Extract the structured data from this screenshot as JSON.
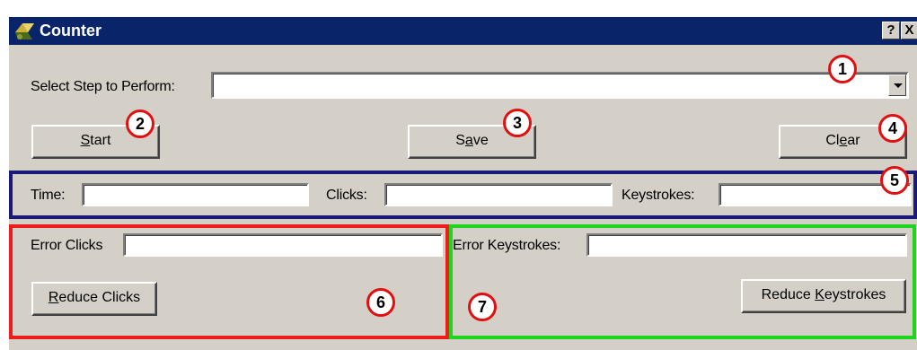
{
  "window": {
    "title": "Counter",
    "help_label": "?",
    "close_label": "X"
  },
  "step": {
    "label": "Select Step to Perform:",
    "value": ""
  },
  "buttons": {
    "start": {
      "pre": "",
      "accel": "S",
      "post": "tart"
    },
    "save": {
      "pre": "S",
      "accel": "a",
      "post": "ve"
    },
    "clear": {
      "pre": "Cl",
      "accel": "e",
      "post": "ar"
    },
    "reduce_clicks": {
      "pre": "",
      "accel": "R",
      "post": "educe Clicks"
    },
    "reduce_keystrokes": {
      "pre": "Reduce ",
      "accel": "K",
      "post": "eystrokes"
    }
  },
  "stats": {
    "time_label": "Time:",
    "time_value": "",
    "clicks_label": "Clicks:",
    "clicks_value": "",
    "keystrokes_label": "Keystrokes:",
    "keystrokes_value": ""
  },
  "errors": {
    "clicks_label": "Error Clicks",
    "clicks_value": "",
    "keystrokes_label": "Error Keystrokes:",
    "keystrokes_value": ""
  },
  "callouts": [
    "1",
    "2",
    "3",
    "4",
    "5",
    "6",
    "7"
  ],
  "colors": {
    "titlebar": "#0a246a",
    "window": "#d4d0c8",
    "callout": "#e01010",
    "box_blue": "#1a1a7a",
    "box_red": "#ee1c1c",
    "box_green": "#1ed51e"
  }
}
